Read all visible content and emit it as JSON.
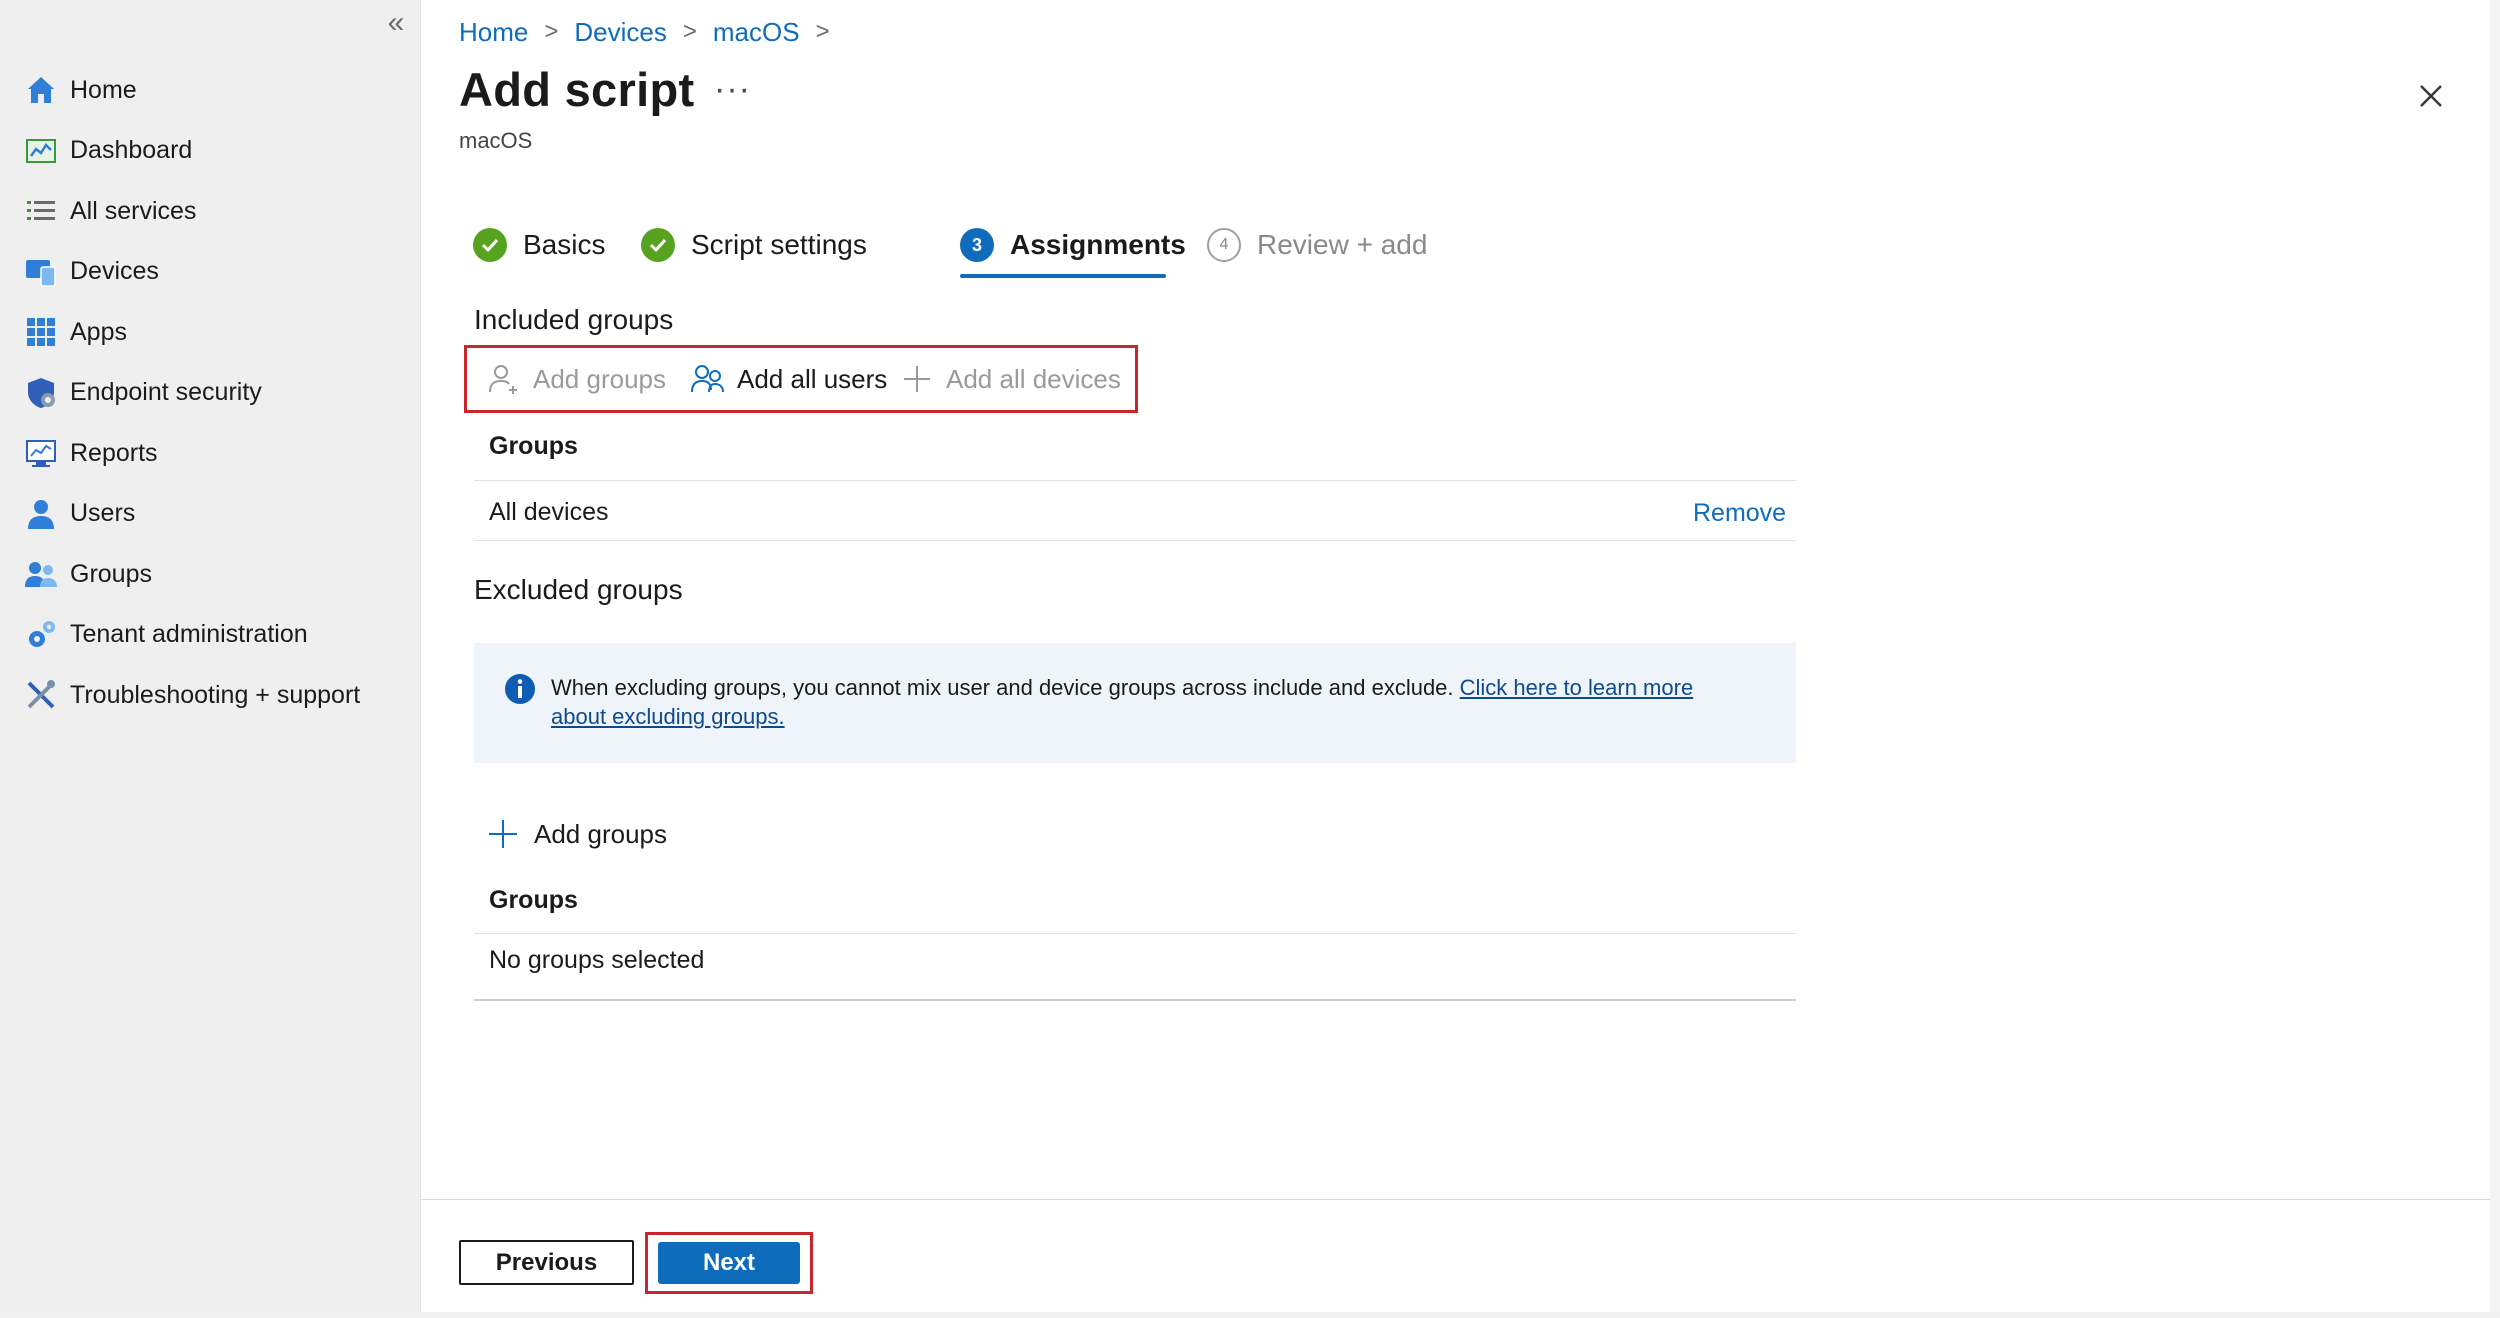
{
  "sidebar": {
    "collapse_icon": "«",
    "items": [
      {
        "label": "Home",
        "icon": "home-icon"
      },
      {
        "label": "Dashboard",
        "icon": "dashboard-icon"
      },
      {
        "label": "All services",
        "icon": "list-icon"
      },
      {
        "label": "Devices",
        "icon": "devices-icon"
      },
      {
        "label": "Apps",
        "icon": "apps-grid-icon"
      },
      {
        "label": "Endpoint security",
        "icon": "shield-icon"
      },
      {
        "label": "Reports",
        "icon": "reports-icon"
      },
      {
        "label": "Users",
        "icon": "user-icon"
      },
      {
        "label": "Groups",
        "icon": "groups-icon"
      },
      {
        "label": "Tenant administration",
        "icon": "gear-icon"
      },
      {
        "label": "Troubleshooting + support",
        "icon": "tools-icon"
      }
    ]
  },
  "breadcrumb": {
    "items": [
      "Home",
      "Devices",
      "macOS"
    ],
    "separator": ">"
  },
  "page": {
    "title": "Add script",
    "more": "···",
    "subtitle": "macOS"
  },
  "steps": [
    {
      "number": "1",
      "label": "Basics",
      "state": "done"
    },
    {
      "number": "2",
      "label": "Script settings",
      "state": "done"
    },
    {
      "number": "3",
      "label": "Assignments",
      "state": "current"
    },
    {
      "number": "4",
      "label": "Review + add",
      "state": "todo"
    }
  ],
  "included": {
    "heading": "Included groups",
    "actions": {
      "add_groups": "Add groups",
      "add_all_users": "Add all users",
      "add_all_devices": "Add all devices"
    },
    "column": "Groups",
    "rows": [
      {
        "name": "All devices",
        "action": "Remove"
      }
    ]
  },
  "excluded": {
    "heading": "Excluded groups",
    "info_text": "When excluding groups, you cannot mix user and device groups across include and exclude. ",
    "info_link": "Click here to learn more about excluding groups.",
    "add_groups": "Add groups",
    "column": "Groups",
    "empty": "No groups selected"
  },
  "footer": {
    "previous": "Previous",
    "next": "Next"
  },
  "colors": {
    "accent": "#0f6cbd",
    "success": "#57a31f",
    "highlight": "#c8262f"
  }
}
